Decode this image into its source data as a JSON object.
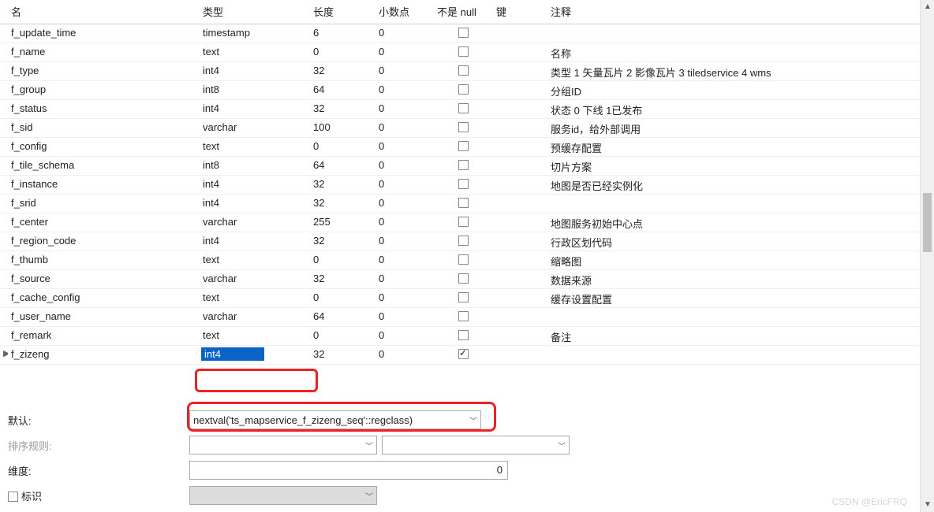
{
  "columns": {
    "name": "名",
    "type": "类型",
    "length": "长度",
    "decimals": "小数点",
    "notnull": "不是 null",
    "key": "键",
    "comment": "注释"
  },
  "rows": [
    {
      "name": "f_update_time",
      "type": "timestamp",
      "length": "6",
      "decimals": "0",
      "notnull": false,
      "comment": ""
    },
    {
      "name": "f_name",
      "type": "text",
      "length": "0",
      "decimals": "0",
      "notnull": false,
      "comment": "名称"
    },
    {
      "name": "f_type",
      "type": "int4",
      "length": "32",
      "decimals": "0",
      "notnull": false,
      "comment": "类型 1 矢量瓦片 2 影像瓦片 3 tiledservice 4 wms"
    },
    {
      "name": "f_group",
      "type": "int8",
      "length": "64",
      "decimals": "0",
      "notnull": false,
      "comment": "分组ID"
    },
    {
      "name": "f_status",
      "type": "int4",
      "length": "32",
      "decimals": "0",
      "notnull": false,
      "comment": "状态 0 下线 1已发布"
    },
    {
      "name": "f_sid",
      "type": "varchar",
      "length": "100",
      "decimals": "0",
      "notnull": false,
      "comment": "服务id，给外部调用"
    },
    {
      "name": "f_config",
      "type": "text",
      "length": "0",
      "decimals": "0",
      "notnull": false,
      "comment": "预缓存配置"
    },
    {
      "name": "f_tile_schema",
      "type": "int8",
      "length": "64",
      "decimals": "0",
      "notnull": false,
      "comment": "切片方案"
    },
    {
      "name": "f_instance",
      "type": "int4",
      "length": "32",
      "decimals": "0",
      "notnull": false,
      "comment": "地图是否已经实例化"
    },
    {
      "name": "f_srid",
      "type": "int4",
      "length": "32",
      "decimals": "0",
      "notnull": false,
      "comment": ""
    },
    {
      "name": "f_center",
      "type": "varchar",
      "length": "255",
      "decimals": "0",
      "notnull": false,
      "comment": "地图服务初始中心点"
    },
    {
      "name": "f_region_code",
      "type": "int4",
      "length": "32",
      "decimals": "0",
      "notnull": false,
      "comment": "行政区划代码"
    },
    {
      "name": "f_thumb",
      "type": "text",
      "length": "0",
      "decimals": "0",
      "notnull": false,
      "comment": "缩略图"
    },
    {
      "name": "f_source",
      "type": "varchar",
      "length": "32",
      "decimals": "0",
      "notnull": false,
      "comment": "数据来源"
    },
    {
      "name": "f_cache_config",
      "type": "text",
      "length": "0",
      "decimals": "0",
      "notnull": false,
      "comment": "缓存设置配置"
    },
    {
      "name": "f_user_name",
      "type": "varchar",
      "length": "64",
      "decimals": "0",
      "notnull": false,
      "comment": ""
    },
    {
      "name": "f_remark",
      "type": "text",
      "length": "0",
      "decimals": "0",
      "notnull": false,
      "comment": "备注"
    },
    {
      "name": "f_zizeng",
      "type": "int4",
      "length": "32",
      "decimals": "0",
      "notnull": true,
      "comment": "",
      "selected": true
    }
  ],
  "bottom": {
    "default_label": "默认:",
    "default_value": "nextval('ts_mapservice_f_zizeng_seq'::regclass)",
    "collation_label": "排序规则:",
    "dimension_label": "维度:",
    "dimension_value": "0",
    "identity_label": "标识"
  },
  "watermark": "CSDN @EricFRQ"
}
